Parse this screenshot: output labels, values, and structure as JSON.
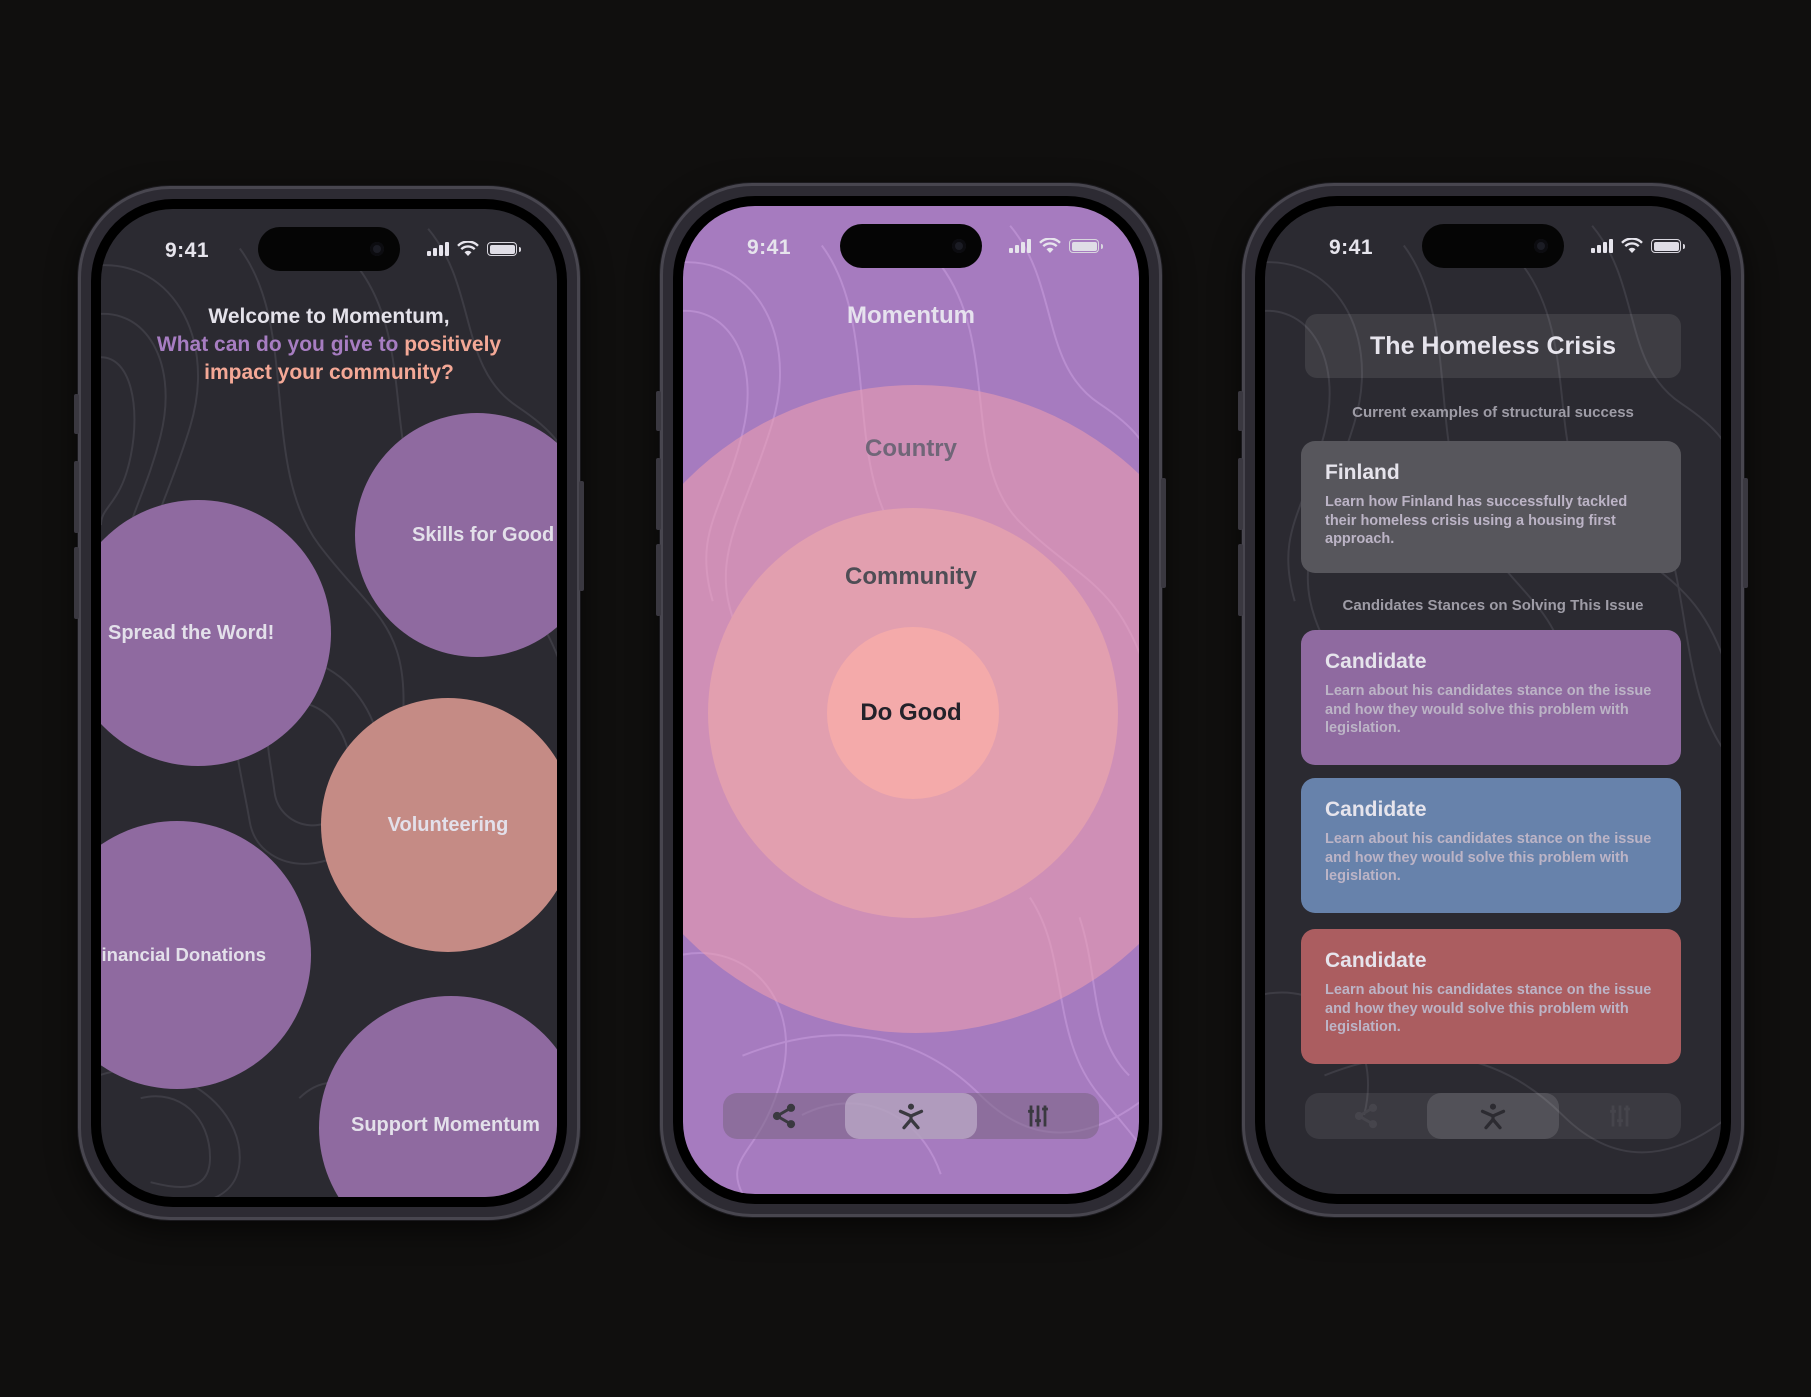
{
  "status_bar": {
    "time": "9:41"
  },
  "phones": [
    {
      "screen": "contribution-picker",
      "welcome": {
        "line1": "Welcome to Momentum,",
        "line2_purple": "What can do you give to ",
        "line2_peach": "positively",
        "line3_peach": "impact your community?"
      },
      "bubbles": [
        {
          "label": "Skills for Good",
          "color": "#8f6aa0"
        },
        {
          "label": "Spread the Word!",
          "color": "#8f6aa0"
        },
        {
          "label": "Volunteering",
          "color": "#c58b85"
        },
        {
          "label": "Financial Donations",
          "color": "#8f6aa0"
        },
        {
          "label": "Support Momentum",
          "color": "#8f6aa0"
        }
      ]
    },
    {
      "screen": "impact-circles",
      "title": "Momentum",
      "rings": [
        {
          "label": "Country",
          "color": "#cb8fb8"
        },
        {
          "label": "Community",
          "color": "#e29faf"
        },
        {
          "label": "Do Good",
          "color": "#f4aaaa"
        }
      ],
      "tabbar": {
        "tabs": [
          {
            "icon": "share-icon",
            "label": "Share"
          },
          {
            "icon": "person-icon",
            "label": "Do Good",
            "active": true
          },
          {
            "icon": "sliders-icon",
            "label": "Settings"
          }
        ]
      }
    },
    {
      "screen": "issue-detail",
      "header_title": "The Homeless Crisis",
      "section1_label": "Current examples of structural success",
      "example_card": {
        "title": "Finland",
        "body": "Learn how Finland has successfully tackled their homeless crisis using a housing first approach.",
        "color": "#57565c"
      },
      "section2_label": "Candidates Stances on Solving This Issue",
      "candidate_cards": [
        {
          "title": "Candidate",
          "body": "Learn about his candidates stance on the issue and how they would solve this problem with legislation.",
          "color": "#8f6aa0"
        },
        {
          "title": "Candidate",
          "body": "Learn about his candidates stance on the issue and how they would solve this problem with legislation.",
          "color": "#6782ab"
        },
        {
          "title": "Candidate",
          "body": "Learn about his candidates stance on the issue and how they would solve this problem with legislation.",
          "color": "#ab5d60"
        }
      ],
      "tabbar": {
        "tabs": [
          {
            "icon": "share-icon",
            "label": "Share"
          },
          {
            "icon": "person-icon",
            "label": "Do Good",
            "active": true
          },
          {
            "icon": "sliders-icon",
            "label": "Settings"
          }
        ]
      }
    }
  ],
  "colors": {
    "background": "#100f0e",
    "dark_screen": "#2b2a31",
    "purple_screen": "#a67bbf",
    "accent_purple": "#a77dc2",
    "accent_peach": "#f4a896"
  }
}
